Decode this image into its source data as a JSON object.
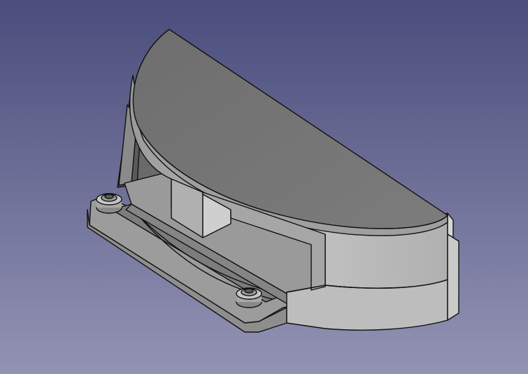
{
  "viewport": {
    "background_top": "#4a4d7c",
    "background_bottom": "#9393b4"
  },
  "model": {
    "fill_light": "#b8b8b8",
    "fill_mid": "#8c8c8c",
    "fill_dark": "#5e5e5e",
    "fill_top": "#7a7a7a",
    "edge": "#111111"
  }
}
